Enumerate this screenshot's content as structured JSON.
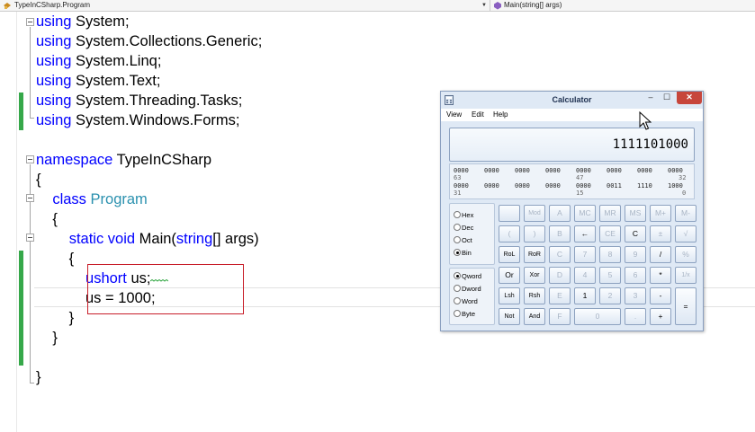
{
  "nav": {
    "type_selector": "TypeInCSharp.Program",
    "member_selector": "Main(string[] args)"
  },
  "code": {
    "lines": [
      {
        "parts": [
          {
            "t": "using",
            "c": "kw"
          },
          {
            "t": " System;",
            "c": ""
          }
        ]
      },
      {
        "parts": [
          {
            "t": "using",
            "c": "kw"
          },
          {
            "t": " System.Collections.Generic;",
            "c": ""
          }
        ]
      },
      {
        "parts": [
          {
            "t": "using",
            "c": "kw"
          },
          {
            "t": " System.Linq;",
            "c": ""
          }
        ]
      },
      {
        "parts": [
          {
            "t": "using",
            "c": "kw"
          },
          {
            "t": " System.Text;",
            "c": ""
          }
        ]
      },
      {
        "parts": [
          {
            "t": "using",
            "c": "kw"
          },
          {
            "t": " System.Threading.Tasks;",
            "c": ""
          }
        ]
      },
      {
        "parts": [
          {
            "t": "using",
            "c": "kw"
          },
          {
            "t": " System.Windows.Forms;",
            "c": ""
          }
        ]
      },
      {
        "parts": []
      },
      {
        "parts": [
          {
            "t": "namespace",
            "c": "kw"
          },
          {
            "t": " TypeInCSharp",
            "c": ""
          }
        ]
      },
      {
        "parts": [
          {
            "t": "{",
            "c": ""
          }
        ]
      },
      {
        "parts": [
          {
            "t": "    ",
            "c": ""
          },
          {
            "t": "class",
            "c": "kw"
          },
          {
            "t": " ",
            "c": ""
          },
          {
            "t": "Program",
            "c": "ty"
          }
        ]
      },
      {
        "parts": [
          {
            "t": "    {",
            "c": ""
          }
        ]
      },
      {
        "parts": [
          {
            "t": "        ",
            "c": ""
          },
          {
            "t": "static",
            "c": "kw"
          },
          {
            "t": " ",
            "c": ""
          },
          {
            "t": "void",
            "c": "kw"
          },
          {
            "t": " Main(",
            "c": ""
          },
          {
            "t": "string",
            "c": "kw"
          },
          {
            "t": "[] args)",
            "c": ""
          }
        ]
      },
      {
        "parts": [
          {
            "t": "        {",
            "c": ""
          }
        ]
      },
      {
        "parts": [
          {
            "t": "            ",
            "c": ""
          },
          {
            "t": "ushort",
            "c": "kw"
          },
          {
            "t": " us;",
            "c": ""
          }
        ]
      },
      {
        "parts": [
          {
            "t": "            us = 1000;",
            "c": ""
          }
        ]
      },
      {
        "parts": [
          {
            "t": "        }",
            "c": ""
          }
        ]
      },
      {
        "parts": [
          {
            "t": "    }",
            "c": ""
          }
        ]
      },
      {
        "parts": []
      },
      {
        "parts": [
          {
            "t": "}",
            "c": ""
          }
        ]
      }
    ]
  },
  "calculator": {
    "title": "Calculator",
    "menu": [
      "View",
      "Edit",
      "Help"
    ],
    "display": "1111101000",
    "bits_row1": [
      "0000",
      "0000",
      "0000",
      "0000",
      "0000",
      "0000",
      "0000",
      "0000"
    ],
    "bits_row1_index": [
      "63",
      "47",
      "32"
    ],
    "bits_row2": [
      "0000",
      "0000",
      "0000",
      "0000",
      "0000",
      "0011",
      "1110",
      "1000"
    ],
    "bits_row2_index": [
      "31",
      "15",
      "0"
    ],
    "base_options": [
      "Hex",
      "Dec",
      "Oct",
      "Bin"
    ],
    "selected_base": "Bin",
    "word_options": [
      "Qword",
      "Dword",
      "Word",
      "Byte"
    ],
    "selected_word": "Qword",
    "buttons": [
      [
        "",
        "Mod",
        "A",
        "MC",
        "MR",
        "MS",
        "M+",
        "M-"
      ],
      [
        "(",
        ")",
        "B",
        "←",
        "CE",
        "C",
        "±",
        "√"
      ],
      [
        "RoL",
        "RoR",
        "C",
        "7",
        "8",
        "9",
        "/",
        "%"
      ],
      [
        "Or",
        "Xor",
        "D",
        "4",
        "5",
        "6",
        "*",
        "1/x"
      ],
      [
        "Lsh",
        "Rsh",
        "E",
        "1",
        "2",
        "3",
        "-",
        "="
      ],
      [
        "Not",
        "And",
        "F",
        "0",
        ".",
        "+"
      ]
    ]
  }
}
